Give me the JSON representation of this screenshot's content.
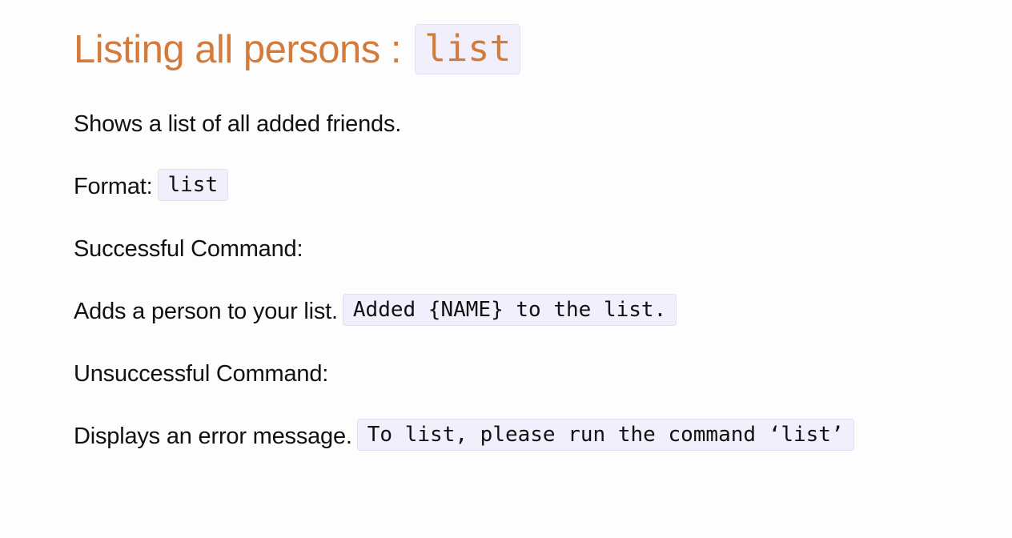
{
  "heading": {
    "text": "Listing all persons : ",
    "code": "list"
  },
  "description": "Shows a list of all added friends.",
  "format": {
    "label": "Format:",
    "code": "list"
  },
  "success": {
    "label": "Successful Command:",
    "description": "Adds a person to your list.",
    "message": "Added {NAME} to the list."
  },
  "failure": {
    "label": "Unsuccessful Command:",
    "description": "Displays an error message.",
    "message": "To list, please run the command ‘list’"
  },
  "colors": {
    "heading": "#d47a3a",
    "code_background": "#f0effb",
    "text": "#111111"
  }
}
